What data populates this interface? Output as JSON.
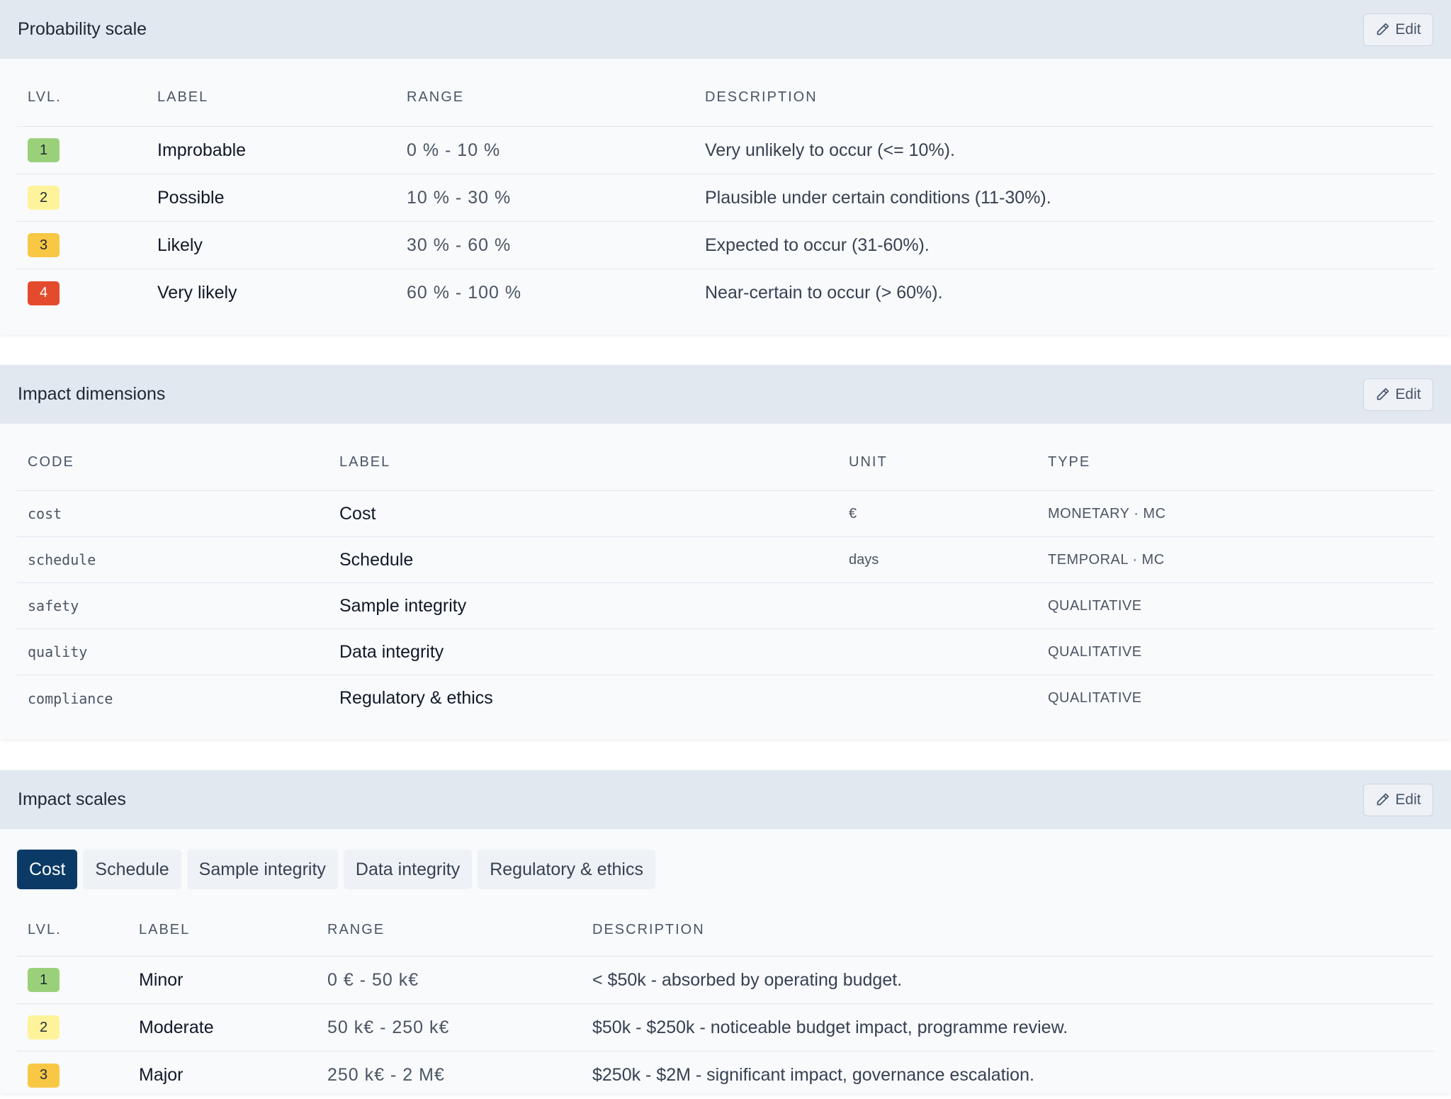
{
  "edit_label": "Edit",
  "probability": {
    "title": "Probability scale",
    "headers": {
      "level": "LVL.",
      "label": "LABEL",
      "range": "RANGE",
      "description": "DESCRIPTION"
    },
    "rows": [
      {
        "level": "1",
        "label": "Improbable",
        "range": "0 % - 10 %",
        "description": "Very unlikely to occur (<= 10%)."
      },
      {
        "level": "2",
        "label": "Possible",
        "range": "10 % - 30 %",
        "description": "Plausible under certain conditions (11-30%)."
      },
      {
        "level": "3",
        "label": "Likely",
        "range": "30 % - 60 %",
        "description": "Expected to occur (31-60%)."
      },
      {
        "level": "4",
        "label": "Very likely",
        "range": "60 % - 100 %",
        "description": "Near-certain to occur (> 60%)."
      }
    ]
  },
  "dimensions": {
    "title": "Impact dimensions",
    "headers": {
      "code": "CODE",
      "label": "LABEL",
      "unit": "UNIT",
      "type": "TYPE"
    },
    "rows": [
      {
        "code": "cost",
        "label": "Cost",
        "unit": "€",
        "type": "MONETARY · MC"
      },
      {
        "code": "schedule",
        "label": "Schedule",
        "unit": "days",
        "type": "TEMPORAL · MC"
      },
      {
        "code": "safety",
        "label": "Sample integrity",
        "unit": "",
        "type": "QUALITATIVE"
      },
      {
        "code": "quality",
        "label": "Data integrity",
        "unit": "",
        "type": "QUALITATIVE"
      },
      {
        "code": "compliance",
        "label": "Regulatory & ethics",
        "unit": "",
        "type": "QUALITATIVE"
      }
    ]
  },
  "scales": {
    "title": "Impact scales",
    "tabs": [
      "Cost",
      "Schedule",
      "Sample integrity",
      "Data integrity",
      "Regulatory & ethics"
    ],
    "active_tab": "Cost",
    "headers": {
      "level": "LVL.",
      "label": "LABEL",
      "range": "RANGE",
      "description": "DESCRIPTION"
    },
    "rows": [
      {
        "level": "1",
        "label": "Minor",
        "range": "0 € - 50 k€",
        "description": "< $50k - absorbed by operating budget."
      },
      {
        "level": "2",
        "label": "Moderate",
        "range": "50 k€ - 250 k€",
        "description": "$50k - $250k - noticeable budget impact, programme review."
      },
      {
        "level": "3",
        "label": "Major",
        "range": "250 k€ - 2 M€",
        "description": "$250k - $2M - significant impact, governance escalation."
      }
    ]
  },
  "level_colors": {
    "1": "#9bd07a",
    "2": "#fef39a",
    "3": "#f8c845",
    "4": "#e34b2c"
  }
}
